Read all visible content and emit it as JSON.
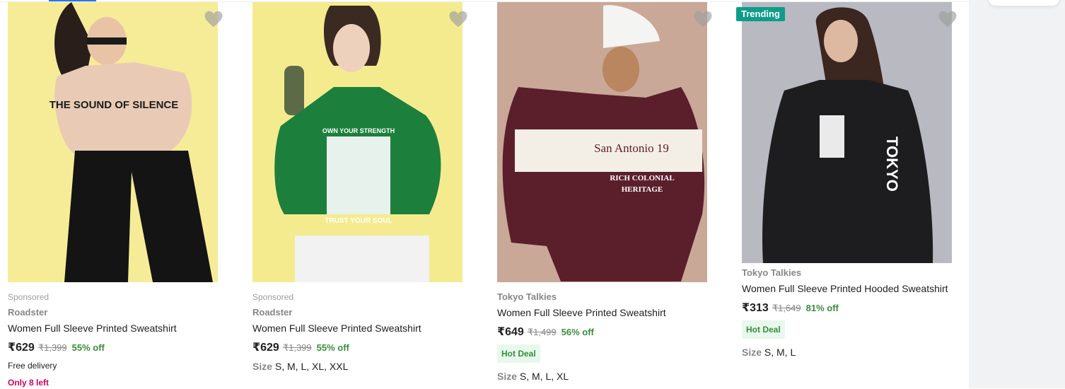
{
  "colors": {
    "price_off": "#388e3c",
    "trending_badge": "#0f9d8a",
    "low_stock": "#d1005b",
    "hot_deal_bg": "#e8f8ec",
    "wishlist_heart": "#9e9e9e"
  },
  "wishlist_icon": "heart-icon",
  "products": [
    {
      "sponsored": "Sponsored",
      "brand": "Roadster",
      "title": "Women Full Sleeve Printed Sweatshirt",
      "price": "₹629",
      "mrp": "₹1,399",
      "discount": "55% off",
      "delivery": "Free delivery",
      "stock": "Only 8 left",
      "image_bg": "#f6ec97",
      "shirt_color": "#e9cbb5",
      "print_text": "THE SOUND OF SILENCE"
    },
    {
      "sponsored": "Sponsored",
      "brand": "Roadster",
      "title": "Women Full Sleeve Printed Sweatshirt",
      "price": "₹629",
      "mrp": "₹1,399",
      "discount": "55% off",
      "size_label": "Size",
      "sizes": "S, M, L, XL, XXL",
      "image_bg": "#f4eb8f",
      "shirt_color": "#1d7f3c",
      "print_top": "OWN YOUR STRENGTH",
      "print_bottom": "TRUST YOUR SOUL"
    },
    {
      "brand": "Tokyo Talkies",
      "title": "Women Full Sleeve Printed Sweatshirt",
      "price": "₹649",
      "mrp": "₹1,499",
      "discount": "56% off",
      "deal": "Hot Deal",
      "size_label": "Size",
      "sizes": "S, M, L, XL",
      "image_bg": "#c9a898",
      "shirt_color": "#5b1f2c",
      "print_top": "San Antonio 19",
      "print_line1": "RICH COLONIAL",
      "print_line2": "HERITAGE"
    },
    {
      "badge": "Trending",
      "brand": "Tokyo Talkies",
      "title": "Women Full Sleeve Printed Hooded Sweatshirt",
      "price": "₹313",
      "mrp": "₹1,649",
      "discount": "81% off",
      "deal": "Hot Deal",
      "size_label": "Size",
      "sizes": "S, M, L",
      "image_bg": "#b8b9c1",
      "shirt_color": "#1d1d1f",
      "print_text": "TOKYO"
    }
  ]
}
